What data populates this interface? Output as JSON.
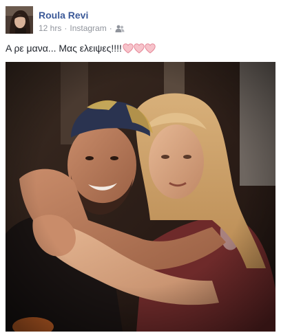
{
  "post": {
    "author": "Roula Revi",
    "time": "12 hrs",
    "separator": "·",
    "source": "Instagram",
    "audience_icon": "friends-icon",
    "message": "Α ρε μανα... Μας ελειψες!!!!",
    "hearts": [
      "heart-icon",
      "heart-icon",
      "heart-icon"
    ],
    "heart_color": "#f4a7b3",
    "author_color": "#3b5998",
    "meta_color": "#90949c"
  }
}
